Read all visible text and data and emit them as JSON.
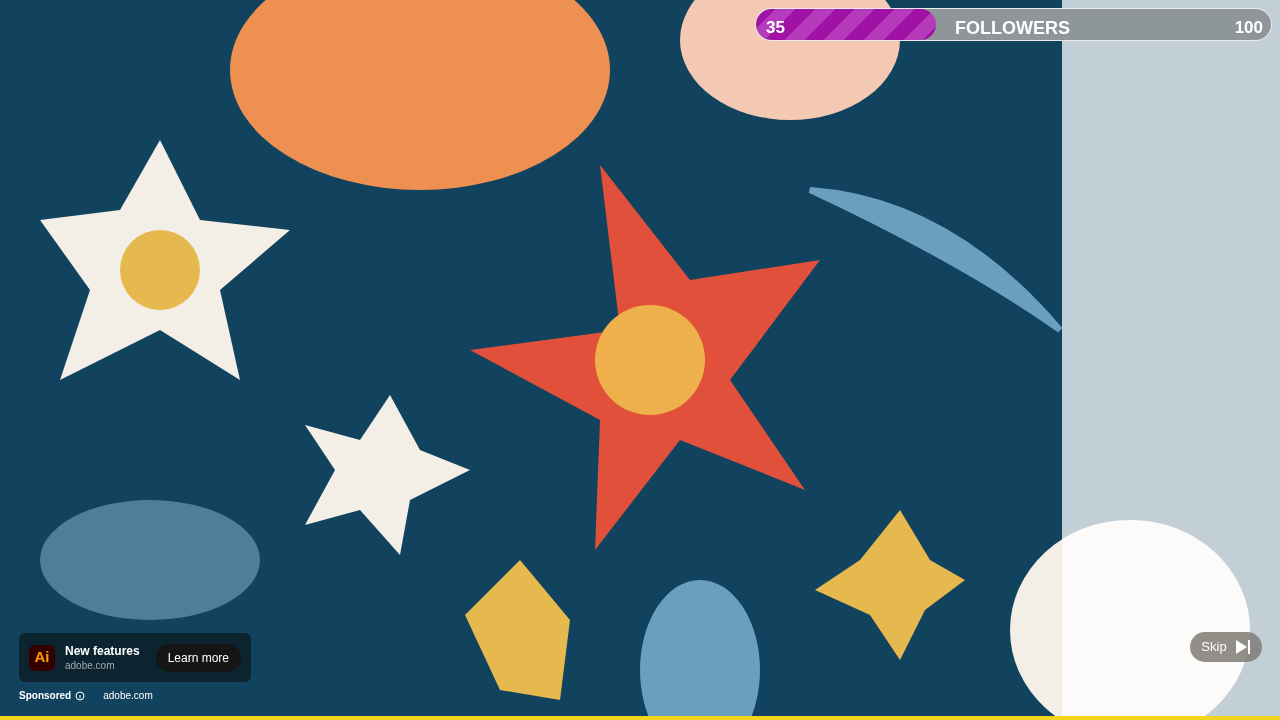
{
  "followers_bar": {
    "count": "35",
    "label": "FOLLOWERS",
    "goal": "100",
    "level": 0.35
  },
  "ad_card": {
    "logo": "Ai",
    "title": "New features",
    "domain": "adobe.com",
    "button": "Learn more"
  },
  "ad_info": {
    "sponsored": "Sponsored",
    "domain": "adobe.com"
  },
  "skip_button": {
    "label": "Skip"
  },
  "ad_progress": {
    "level": 1
  }
}
